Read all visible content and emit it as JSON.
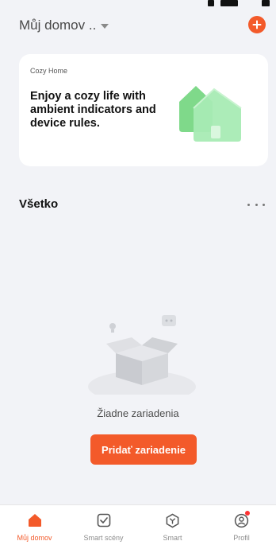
{
  "header": {
    "home_name": "Můj domov ..",
    "add_icon": "plus-circle-icon"
  },
  "banner": {
    "kicker": "Cozy Home",
    "headline": "Enjoy a cozy life with ambient indicators and device rules.",
    "illustration": "green-houses-icon"
  },
  "section": {
    "title": "Všetko",
    "more_icon": "more-dots-icon"
  },
  "empty_state": {
    "illustration": "empty-box-icon",
    "message": "Žiadne zariadenia",
    "button_label": "Pridať zariadenie"
  },
  "tabs": [
    {
      "label": "Můj domov",
      "icon": "home-icon",
      "active": true
    },
    {
      "label": "Smart scény",
      "icon": "checkbox-icon",
      "active": false
    },
    {
      "label": "Smart",
      "icon": "smart-hex-icon",
      "active": false
    },
    {
      "label": "Profil",
      "icon": "profile-icon",
      "active": false,
      "badge": true
    }
  ],
  "colors": {
    "accent": "#f35a2a",
    "background": "#f2f3f7",
    "card": "#ffffff",
    "tab_inactive": "#8c8c8c"
  }
}
